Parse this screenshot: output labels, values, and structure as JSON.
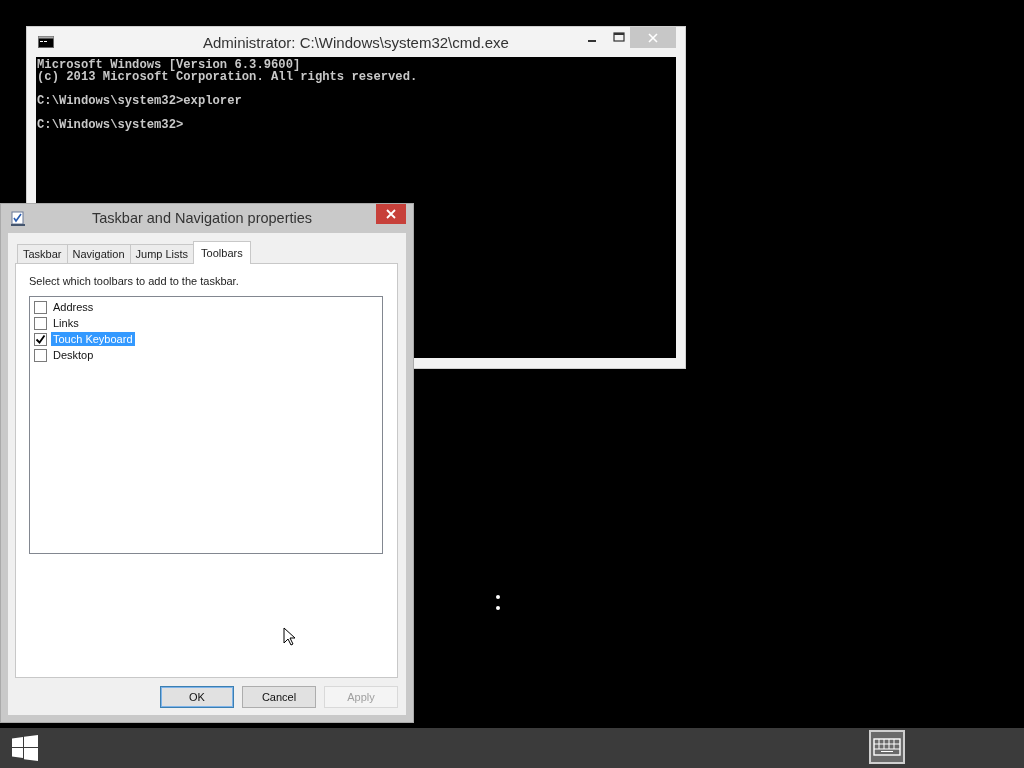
{
  "console_window": {
    "title": "Administrator: C:\\Windows\\system32\\cmd.exe",
    "paragraphs": [
      [
        "Microsoft Windows [Version 6.3.9600]",
        "(c) 2013 Microsoft Corporation. All rights reserved."
      ],
      [
        "C:\\Windows\\system32>explorer"
      ],
      [
        "C:\\Windows\\system32>"
      ]
    ]
  },
  "dialog": {
    "title": "Taskbar and Navigation properties",
    "tabs": [
      {
        "label": "Taskbar",
        "selected": false
      },
      {
        "label": "Navigation",
        "selected": false
      },
      {
        "label": "Jump Lists",
        "selected": false
      },
      {
        "label": "Toolbars",
        "selected": true
      }
    ],
    "instruction": "Select which toolbars to add to the taskbar.",
    "toolbars": [
      {
        "label": "Address",
        "checked": false,
        "selected": false
      },
      {
        "label": "Links",
        "checked": false,
        "selected": false
      },
      {
        "label": "Touch Keyboard",
        "checked": true,
        "selected": true
      },
      {
        "label": "Desktop",
        "checked": false,
        "selected": false
      }
    ],
    "buttons": [
      {
        "label": "OK",
        "kind": "default",
        "disabled": false
      },
      {
        "label": "Cancel",
        "kind": "normal",
        "disabled": false
      },
      {
        "label": "Apply",
        "kind": "normal",
        "disabled": true
      }
    ]
  },
  "taskbar": {
    "touch_keyboard_button": {
      "selected": true
    }
  }
}
